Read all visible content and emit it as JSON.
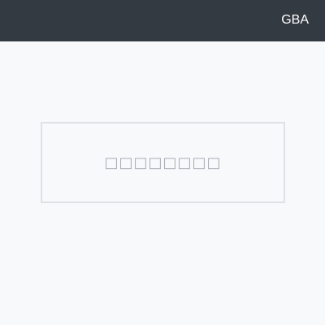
{
  "header": {
    "label": "GBA",
    "background_color": "#343a42",
    "text_color": "#ffffff"
  },
  "main": {
    "background_color": "#f8f9fb",
    "placeholder_box": {
      "text": "□□□□□□□□",
      "border_color": "#dfe1e5",
      "text_color": "#a9adb3"
    }
  }
}
